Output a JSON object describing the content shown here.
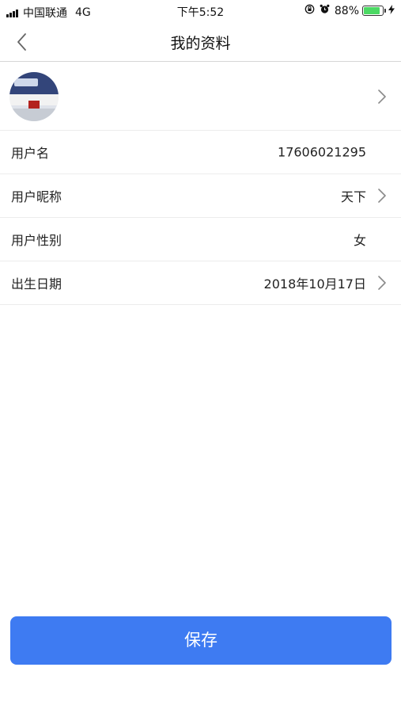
{
  "status_bar": {
    "carrier": "中国联通",
    "network": "4G",
    "time": "下午5:52",
    "battery_text": "88%",
    "battery_level": 0.88,
    "icons": [
      "signal-icon",
      "orientation-lock-icon",
      "alarm-icon",
      "battery-icon",
      "charging-icon"
    ]
  },
  "nav": {
    "title": "我的资料",
    "back_icon": "chevron-left-icon"
  },
  "profile": {
    "avatar": "avatar-image",
    "rows": [
      {
        "label": "用户名",
        "value": "17606021295",
        "has_chevron": false
      },
      {
        "label": "用户昵称",
        "value": "天下",
        "has_chevron": true
      },
      {
        "label": "用户性别",
        "value": "女",
        "has_chevron": false
      },
      {
        "label": "出生日期",
        "value": "2018年10月17日",
        "has_chevron": true
      }
    ]
  },
  "save_label": "保存",
  "colors": {
    "primary_button": "#3e7bf2",
    "battery_green": "#4cd964",
    "divider": "#ececec"
  }
}
